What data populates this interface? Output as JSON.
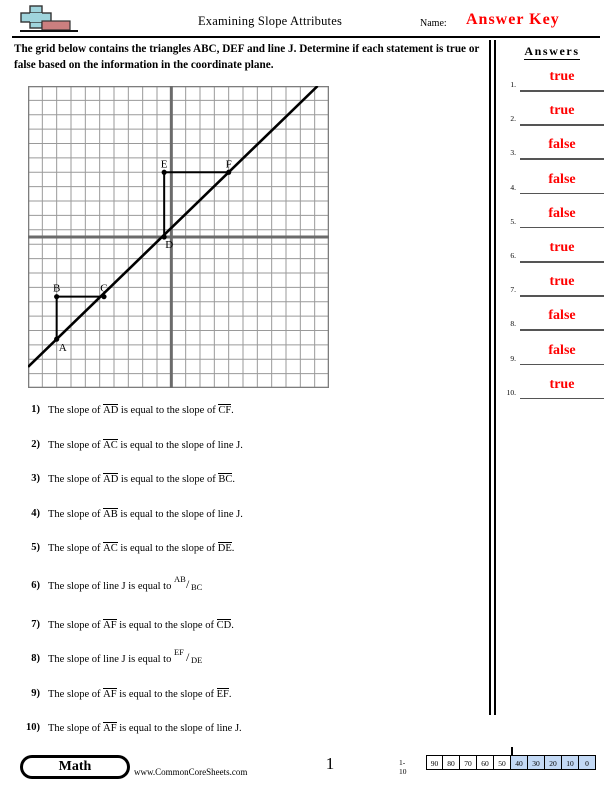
{
  "header": {
    "title": "Examining Slope Attributes",
    "name_label": "Name:",
    "answer_key": "Answer Key",
    "logo_icon": "plus-block-logo"
  },
  "instructions": "The grid below contains the triangles ABC, DEF and line J. Determine if each statement is true or false based on the information in the coordinate plane.",
  "answers_panel": {
    "title": "Answers",
    "rows": [
      {
        "num": "1.",
        "value": "true"
      },
      {
        "num": "2.",
        "value": "true"
      },
      {
        "num": "3.",
        "value": "false"
      },
      {
        "num": "4.",
        "value": "false"
      },
      {
        "num": "5.",
        "value": "false"
      },
      {
        "num": "6.",
        "value": "true"
      },
      {
        "num": "7.",
        "value": "true"
      },
      {
        "num": "8.",
        "value": "false"
      },
      {
        "num": "9.",
        "value": "false"
      },
      {
        "num": "10.",
        "value": "true"
      }
    ]
  },
  "chart_data": {
    "type": "scatter",
    "title": "",
    "xlabel": "",
    "ylabel": "",
    "grid": true,
    "legend": "none",
    "grid_cols": 21,
    "grid_rows": 21,
    "xlim": [
      -10,
      11
    ],
    "ylim": [
      -10.5,
      10.5
    ],
    "axes": {
      "x_axis_row": 10.5,
      "y_axis_col": 10
    },
    "points": [
      {
        "label": "A",
        "x": 2,
        "y": -8,
        "label_pos": "below-right"
      },
      {
        "label": "B",
        "x": 2,
        "y": -5,
        "label_pos": "above"
      },
      {
        "label": "C",
        "x": 5.3,
        "y": -5,
        "label_pos": "above"
      },
      {
        "label": "D",
        "x": 9.5,
        "y": 0,
        "label_pos": "below-right"
      },
      {
        "label": "E",
        "x": 9.5,
        "y": 4.5,
        "label_pos": "above"
      },
      {
        "label": "F",
        "x": 14,
        "y": 4.5,
        "label_pos": "above"
      }
    ],
    "segments": [
      {
        "name": "AB",
        "from": "A",
        "to": "B"
      },
      {
        "name": "BC",
        "from": "B",
        "to": "C"
      },
      {
        "name": "AC",
        "from": "A",
        "to": "C"
      },
      {
        "name": "DE",
        "from": "D",
        "to": "E"
      },
      {
        "name": "EF",
        "from": "E",
        "to": "F"
      },
      {
        "name": "DF",
        "from": "D",
        "to": "F"
      }
    ],
    "line": {
      "label": "J",
      "description": "line through A, C, D and F",
      "slope": 0.91
    }
  },
  "questions": [
    {
      "num": "1)",
      "parts": [
        {
          "t": "text",
          "v": "The slope of "
        },
        {
          "t": "ovl",
          "v": "AD"
        },
        {
          "t": "text",
          "v": " is equal to the slope of "
        },
        {
          "t": "ovl",
          "v": "CF"
        },
        {
          "t": "text",
          "v": "."
        }
      ]
    },
    {
      "num": "2)",
      "parts": [
        {
          "t": "text",
          "v": "The slope of "
        },
        {
          "t": "ovl",
          "v": "AC"
        },
        {
          "t": "text",
          "v": " is equal to the slope of line J."
        }
      ]
    },
    {
      "num": "3)",
      "parts": [
        {
          "t": "text",
          "v": "The slope of "
        },
        {
          "t": "ovl",
          "v": "AD"
        },
        {
          "t": "text",
          "v": " is equal to the slope of "
        },
        {
          "t": "ovl",
          "v": "BC"
        },
        {
          "t": "text",
          "v": "."
        }
      ]
    },
    {
      "num": "4)",
      "parts": [
        {
          "t": "text",
          "v": "The slope of "
        },
        {
          "t": "ovl",
          "v": "AB"
        },
        {
          "t": "text",
          "v": " is equal to the slope of line J."
        }
      ]
    },
    {
      "num": "5)",
      "parts": [
        {
          "t": "text",
          "v": "The slope of "
        },
        {
          "t": "ovl",
          "v": "AC"
        },
        {
          "t": "text",
          "v": " is equal to the slope of "
        },
        {
          "t": "ovl",
          "v": "DE"
        },
        {
          "t": "text",
          "v": "."
        }
      ]
    },
    {
      "num": "6)",
      "parts": [
        {
          "t": "text",
          "v": "The slope of line J is equal to "
        },
        {
          "t": "frac",
          "nu": "AB",
          "de": "BC"
        }
      ]
    },
    {
      "num": "7)",
      "parts": [
        {
          "t": "text",
          "v": "The slope of "
        },
        {
          "t": "ovl",
          "v": "AF"
        },
        {
          "t": "text",
          "v": " is equal to the slope of "
        },
        {
          "t": "ovl",
          "v": "CD"
        },
        {
          "t": "text",
          "v": "."
        }
      ]
    },
    {
      "num": "8)",
      "parts": [
        {
          "t": "text",
          "v": "The slope of line J is equal to "
        },
        {
          "t": "frac",
          "nu": "EF",
          "de": "DE"
        }
      ]
    },
    {
      "num": "9)",
      "parts": [
        {
          "t": "text",
          "v": "The slope of "
        },
        {
          "t": "ovl",
          "v": "AF"
        },
        {
          "t": "text",
          "v": " is equal to the slope of "
        },
        {
          "t": "ovl",
          "v": "EF"
        },
        {
          "t": "text",
          "v": "."
        }
      ]
    },
    {
      "num": "10)",
      "parts": [
        {
          "t": "text",
          "v": "The slope of "
        },
        {
          "t": "ovl",
          "v": "AF"
        },
        {
          "t": "text",
          "v": " is equal to the slope of line J."
        }
      ]
    }
  ],
  "footer": {
    "subject": "Math",
    "website": "www.CommonCoreSheets.com",
    "page_number": "1",
    "scale_label": "1-10",
    "scale_values": [
      "90",
      "80",
      "70",
      "60",
      "50",
      "40",
      "30",
      "20",
      "10",
      "0"
    ],
    "scale_highlight_from_index": 5,
    "scale_highlight_color": "#c3d9f5"
  }
}
